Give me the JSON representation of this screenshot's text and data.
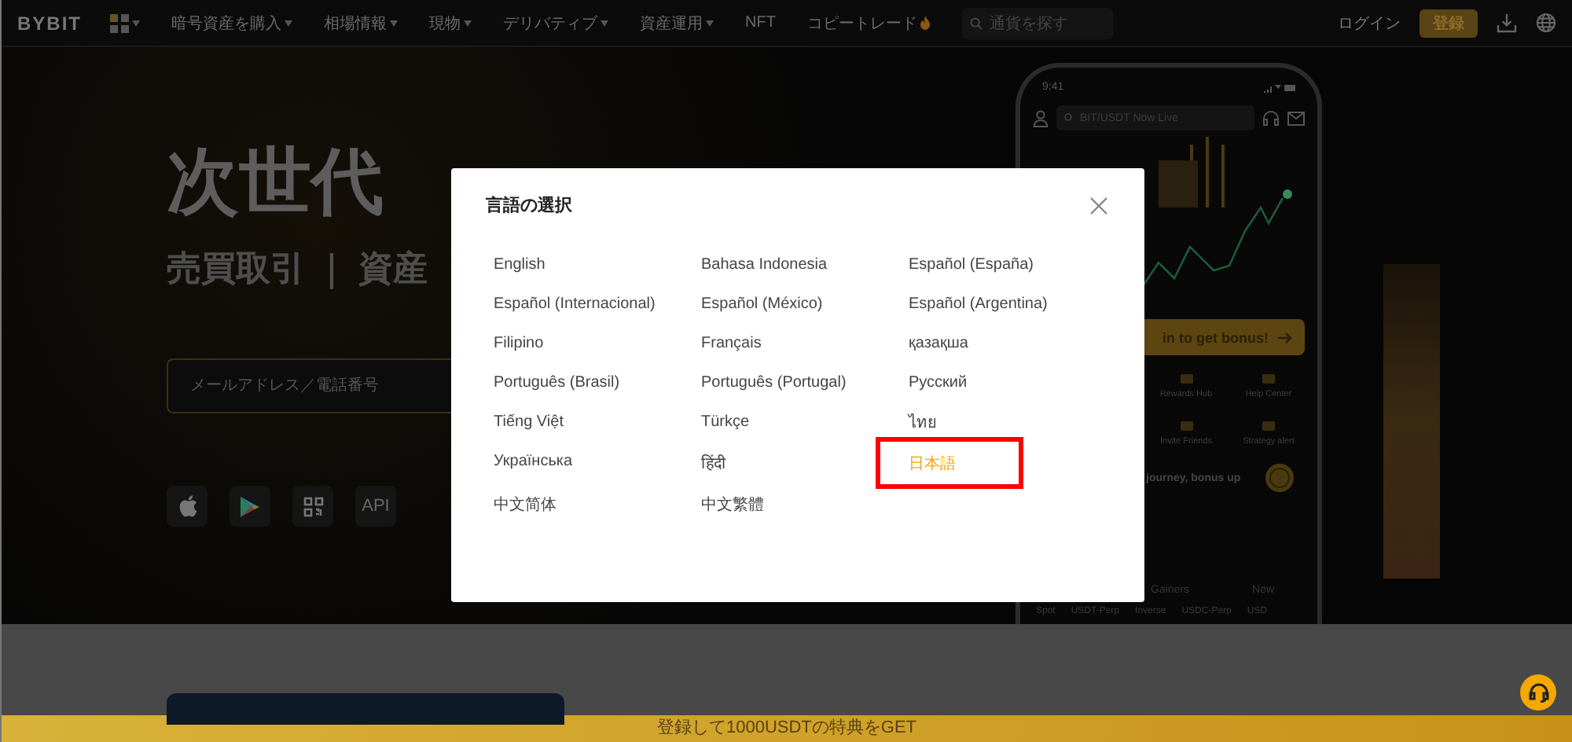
{
  "header": {
    "logo": "BYBIT",
    "nav": [
      {
        "label": "暗号資産を購入",
        "dropdown": true,
        "hot": false
      },
      {
        "label": "相場情報",
        "dropdown": true,
        "hot": false
      },
      {
        "label": "現物",
        "dropdown": true,
        "hot": false
      },
      {
        "label": "デリバティブ",
        "dropdown": true,
        "hot": false
      },
      {
        "label": "資産運用",
        "dropdown": true,
        "hot": false
      },
      {
        "label": "NFT",
        "dropdown": false,
        "hot": false
      },
      {
        "label": "コピートレード",
        "dropdown": false,
        "hot": true
      }
    ],
    "search": {
      "placeholder": "通貨を探す"
    },
    "login": "ログイン",
    "signup": "登録"
  },
  "hero": {
    "headline": "次世代",
    "subline": "売買取引 ｜ 資産",
    "email": {
      "placeholder": "メールアドレス／電話番号"
    },
    "apps": [
      {
        "kind": "apple"
      },
      {
        "kind": "play"
      },
      {
        "kind": "qr"
      },
      {
        "kind": "text",
        "label": "API"
      }
    ]
  },
  "phone": {
    "time": "9:41",
    "search": "BIT/USDT Now Live",
    "bonus_button": "in to get bonus!",
    "shortcuts": [
      "Rewards Hub",
      "Help Center",
      "Invite Friends",
      "Strategy alert"
    ],
    "promo": "journey, bonus up",
    "tabs": [
      "Gainers",
      "New"
    ],
    "markets": [
      "Spot",
      "USDT-Perp",
      "Inverse",
      "USDC-Perp",
      "USD"
    ]
  },
  "dialog": {
    "title": "言語の選択",
    "languages": [
      {
        "label": "English",
        "selected": false
      },
      {
        "label": "Bahasa Indonesia",
        "selected": false
      },
      {
        "label": "Español (España)",
        "selected": false
      },
      {
        "label": "Español (Internacional)",
        "selected": false
      },
      {
        "label": "Español (México)",
        "selected": false
      },
      {
        "label": "Español (Argentina)",
        "selected": false
      },
      {
        "label": "Filipino",
        "selected": false
      },
      {
        "label": "Français",
        "selected": false
      },
      {
        "label": "қазақша",
        "selected": false
      },
      {
        "label": "Português (Brasil)",
        "selected": false
      },
      {
        "label": "Português (Portugal)",
        "selected": false
      },
      {
        "label": "Русский",
        "selected": false
      },
      {
        "label": "Tiếng Việt",
        "selected": false
      },
      {
        "label": "Türkçe",
        "selected": false
      },
      {
        "label": "ไทย",
        "selected": false
      },
      {
        "label": "Українська",
        "selected": false
      },
      {
        "label": "हिंदी",
        "selected": false
      },
      {
        "label": "日本語",
        "selected": true
      },
      {
        "label": "中文简体",
        "selected": false
      },
      {
        "label": "中文繁體",
        "selected": false
      }
    ]
  },
  "banner": "登録して1000USDTの特典をGET"
}
